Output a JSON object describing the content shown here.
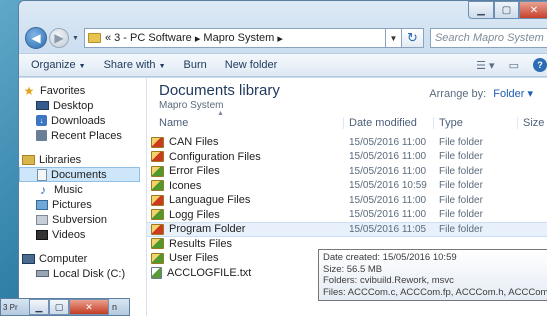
{
  "address": {
    "path_prefix": "«",
    "crumbs": [
      "3 - PC Software",
      "Mapro System"
    ],
    "separator": "▸",
    "search_placeholder": "Search Mapro System"
  },
  "toolbar": {
    "organize": "Organize",
    "share_with": "Share with",
    "burn": "Burn",
    "new_folder": "New folder"
  },
  "nav": {
    "favorites": "Favorites",
    "desktop": "Desktop",
    "downloads": "Downloads",
    "recent_places": "Recent Places",
    "libraries": "Libraries",
    "documents": "Documents",
    "music": "Music",
    "pictures": "Pictures",
    "subversion": "Subversion",
    "videos": "Videos",
    "computer": "Computer",
    "local_disk": "Local Disk (C:)"
  },
  "library": {
    "title": "Documents library",
    "subtitle": "Mapro System",
    "arrange_label": "Arrange by:",
    "arrange_value": "Folder"
  },
  "columns": {
    "name": "Name",
    "date": "Date modified",
    "type": "Type",
    "size": "Size"
  },
  "files": [
    {
      "name": "CAN Files",
      "date": "15/05/2016 11:00",
      "type": "File folder",
      "icon": "folder-red"
    },
    {
      "name": "Configuration Files",
      "date": "15/05/2016 11:00",
      "type": "File folder",
      "icon": "folder-red"
    },
    {
      "name": "Error Files",
      "date": "15/05/2016 11:00",
      "type": "File folder",
      "icon": "folder-green"
    },
    {
      "name": "Icones",
      "date": "15/05/2016 10:59",
      "type": "File folder",
      "icon": "folder-green"
    },
    {
      "name": "Languague Files",
      "date": "15/05/2016 11:00",
      "type": "File folder",
      "icon": "folder-red"
    },
    {
      "name": "Logg Files",
      "date": "15/05/2016 11:00",
      "type": "File folder",
      "icon": "folder-green"
    },
    {
      "name": "Program Folder",
      "date": "15/05/2016 11:05",
      "type": "File folder",
      "icon": "folder-red"
    },
    {
      "name": "Results Files",
      "date": "",
      "type": "",
      "icon": "folder-green"
    },
    {
      "name": "User Files",
      "date": "",
      "type": "",
      "icon": "folder-green"
    },
    {
      "name": "ACCLOGFILE.txt",
      "date": "",
      "type": "",
      "icon": "file-green"
    }
  ],
  "tooltip": {
    "line1": "Date created: 15/05/2016 10:59",
    "line2": "Size: 56.5 MB",
    "line3": "Folders: cvibuild.Rework, msvc",
    "line4": "Files: ACCCom.c, ACCCom.fp, ACCCom.h, ACCCom..."
  },
  "taskbar_thumb": {
    "label": "3 Pr",
    "trailing": "n"
  }
}
